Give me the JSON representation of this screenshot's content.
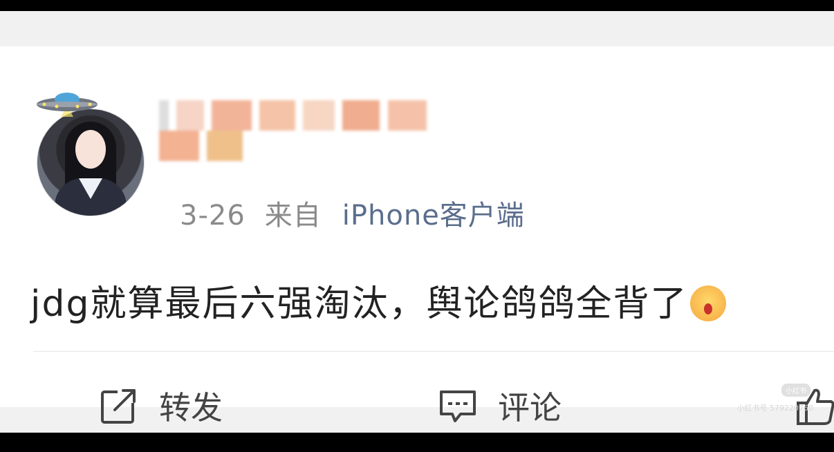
{
  "post": {
    "date": "3-26",
    "from_label": "来自",
    "source": "iPhone客户端",
    "text": "jdg就算最后六强淘汰，舆论鸽鸽全背了",
    "emoji": "shocked-emoji-icon"
  },
  "actions": {
    "repost_label": "转发",
    "comment_label": "评论"
  },
  "watermark": {
    "logo": "小红书",
    "text": "小红书号 579220760"
  },
  "colors": {
    "meta_text": "#8a8a8a",
    "source_link": "#5a6d8c",
    "post_text": "#222222",
    "card_bg": "#ffffff",
    "page_bg": "#f1f1f1"
  }
}
